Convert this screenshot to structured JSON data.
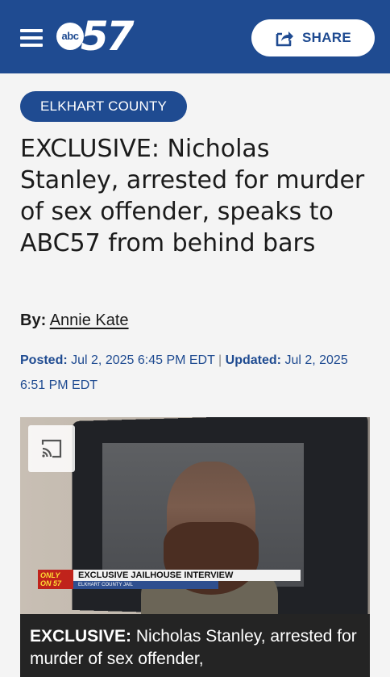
{
  "header": {
    "logo_abc": "abc",
    "logo_num": "57",
    "share_label": "SHARE",
    "share_icon": "share-arrow-icon",
    "menu_icon": "hamburger-menu-icon",
    "brand_color": "#1f4b91"
  },
  "article": {
    "category": "ELKHART COUNTY",
    "headline": "EXCLUSIVE: Nicholas Stanley, arrested for murder of sex offender, speaks to ABC57 from behind bars",
    "byline_label": "By:",
    "author": "Annie Kate",
    "posted_label": "Posted:",
    "posted_date": "Jul 2, 2025 6:45 PM EDT",
    "separator": "|",
    "updated_label": "Updated:",
    "updated_date": "Jul 2, 2025 6:51 PM EDT"
  },
  "video": {
    "cast_icon": "cast-icon",
    "lower_third_badge": "ONLY ON 57",
    "lower_third_title": "EXCLUSIVE JAILHOUSE INTERVIEW",
    "lower_third_sub": "ELKHART COUNTY JAIL",
    "caption_bold": "EXCLUSIVE:",
    "caption_text": " Nicholas Stanley, arrested for murder of sex offender,"
  }
}
